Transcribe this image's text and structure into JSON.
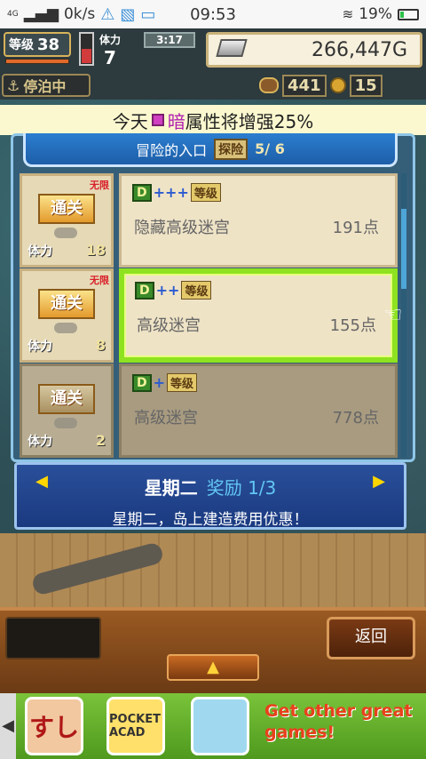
{
  "status_bar": {
    "network": "4G",
    "speed": "0k/s",
    "time": "09:53",
    "battery": "19%"
  },
  "hud": {
    "level_label": "等级",
    "level": "38",
    "stamina_label": "体力",
    "stamina": "7",
    "timer": "3:17",
    "gold": "266,447G",
    "anchored_label": "停泊中",
    "counter_a": "441",
    "counter_b": "15"
  },
  "banner": {
    "prefix": "今天",
    "attribute": "暗",
    "suffix": "属性将增强25%"
  },
  "panel": {
    "title": "冒险的入口",
    "badge": "探险",
    "progress": "5/ 6",
    "clear_label": "通关",
    "unlimited_label": "无限",
    "cost_label": "体力",
    "rank_label": "等级",
    "rows": [
      {
        "rank_letter": "D",
        "plus": "+++",
        "name": "隐藏高级迷宫",
        "points": "191点",
        "cost": "18",
        "unlimited": true
      },
      {
        "rank_letter": "D",
        "plus": "++",
        "name": "高级迷宫",
        "points": "155点",
        "cost": "8",
        "unlimited": true
      },
      {
        "rank_letter": "D",
        "plus": "+",
        "name": "高级迷宫",
        "points": "778点",
        "cost": "2",
        "unlimited": false
      }
    ]
  },
  "reward": {
    "day": "星期二",
    "reward_text": "奖励 1/3",
    "description": "星期二，岛上建造费用优惠！"
  },
  "bottom": {
    "back_label": "返回"
  },
  "ad": {
    "app1": "すし",
    "app2": "POCKET ACAD",
    "cta": "Get other great games!"
  },
  "icons": {
    "wifi": "wifi-icon",
    "battery": "battery-icon",
    "anchor": "anchor-icon",
    "ingot": "silver-ingot-icon",
    "coin": "coin-icon",
    "hand": "pointing-hand-icon"
  },
  "colors": {
    "banner_bg": "#fbf8cf",
    "attribute": "#b01eb0",
    "selected_border": "#8fe21f",
    "reward_bg": "#1a3a80",
    "reward_accent": "#62c6f2"
  }
}
